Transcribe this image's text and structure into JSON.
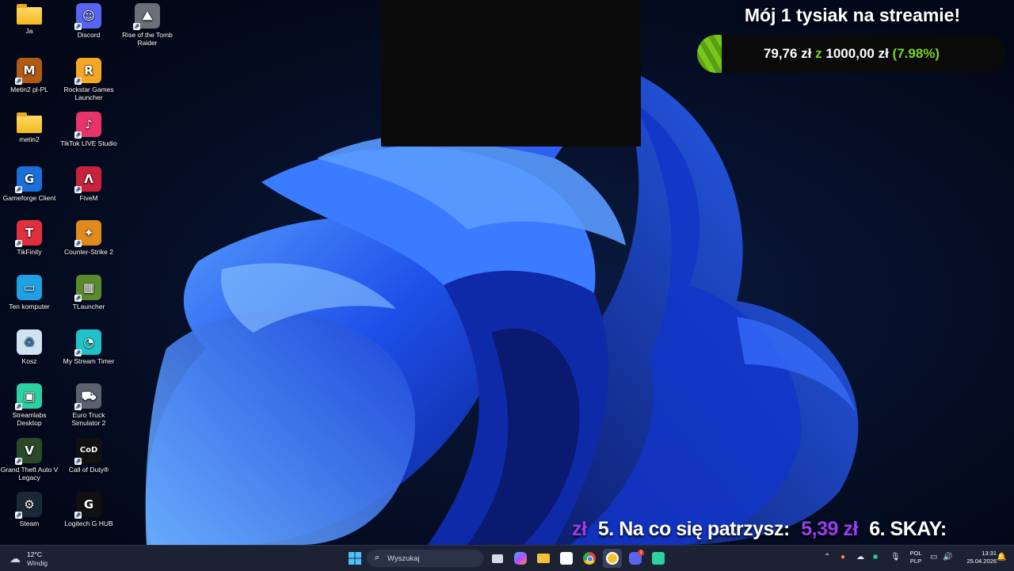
{
  "desktop_icons": [
    {
      "label": "Ja",
      "icon": "folder-icon",
      "color": "#f4b820"
    },
    {
      "label": "Discord",
      "icon": "discord-icon",
      "color": "#5865f2"
    },
    {
      "label": "Rise of the Tomb Raider",
      "icon": "tomb-raider-icon",
      "color": "#6a6f78"
    },
    {
      "label": "Metin2 pl-PL",
      "icon": "metin2-icon",
      "color": "#b05a14"
    },
    {
      "label": "Rockstar Games Launcher",
      "icon": "rockstar-icon",
      "color": "#f5a623"
    },
    {
      "label": "metin2",
      "icon": "folder-icon",
      "color": "#f4b820"
    },
    {
      "label": "TikTok LIVE Studio",
      "icon": "tiktok-live-icon",
      "color": "#e8336b"
    },
    {
      "label": "Gameforge Client",
      "icon": "gameforge-icon",
      "color": "#1a6fd8"
    },
    {
      "label": "FiveM",
      "icon": "fivem-icon",
      "color": "#c8233c"
    },
    {
      "label": "TikFinity",
      "icon": "tikfinity-icon",
      "color": "#e0303e"
    },
    {
      "label": "Counter-Strike 2",
      "icon": "cs2-icon",
      "color": "#e08a1e"
    },
    {
      "label": "Ten komputer",
      "icon": "monitor-icon",
      "color": "#1fa0e0"
    },
    {
      "label": "TLauncher",
      "icon": "minecraft-icon",
      "color": "#5b8a2e"
    },
    {
      "label": "Kosz",
      "icon": "recycle-bin-icon",
      "color": "#cfe3f2"
    },
    {
      "label": "My Stream Timer",
      "icon": "stream-timer-icon",
      "color": "#1ec3c8"
    },
    {
      "label": "Streamlabs Desktop",
      "icon": "streamlabs-icon",
      "color": "#2bd1a0"
    },
    {
      "label": "Euro Truck Simulator 2",
      "icon": "truck-icon",
      "color": "#5a6270"
    },
    {
      "label": "Grand Theft Auto V Legacy",
      "icon": "gta-v-icon",
      "color": "#2a4a2a"
    },
    {
      "label": "Call of Duty®",
      "icon": "call-of-duty-icon",
      "color": "#111111"
    },
    {
      "label": "Steam",
      "icon": "steam-icon",
      "color": "#1b2838"
    },
    {
      "label": "Logitech G HUB",
      "icon": "logitech-icon",
      "color": "#111111"
    }
  ],
  "goal": {
    "title": "Mój 1 tysiak na streamie!",
    "current": "79,76 zł",
    "separator": "z",
    "target": "1000,00 zł",
    "percent_text": "(7.98%)",
    "progress": 0.0798,
    "fill_color": "#78c81c"
  },
  "ticker": {
    "prefix": "zł",
    "item_label": "5. Na co się patrzysz:",
    "item_amount": "5,39 zł",
    "next_label": "6. SKAY:"
  },
  "taskbar": {
    "weather_temp": "12°C",
    "weather_cond": "Windig",
    "search_placeholder": "Wyszukaj",
    "lang_top": "POL",
    "lang_bottom": "PLP",
    "time": "13:31",
    "date": "25.04.2026",
    "discord_badge": "1"
  }
}
